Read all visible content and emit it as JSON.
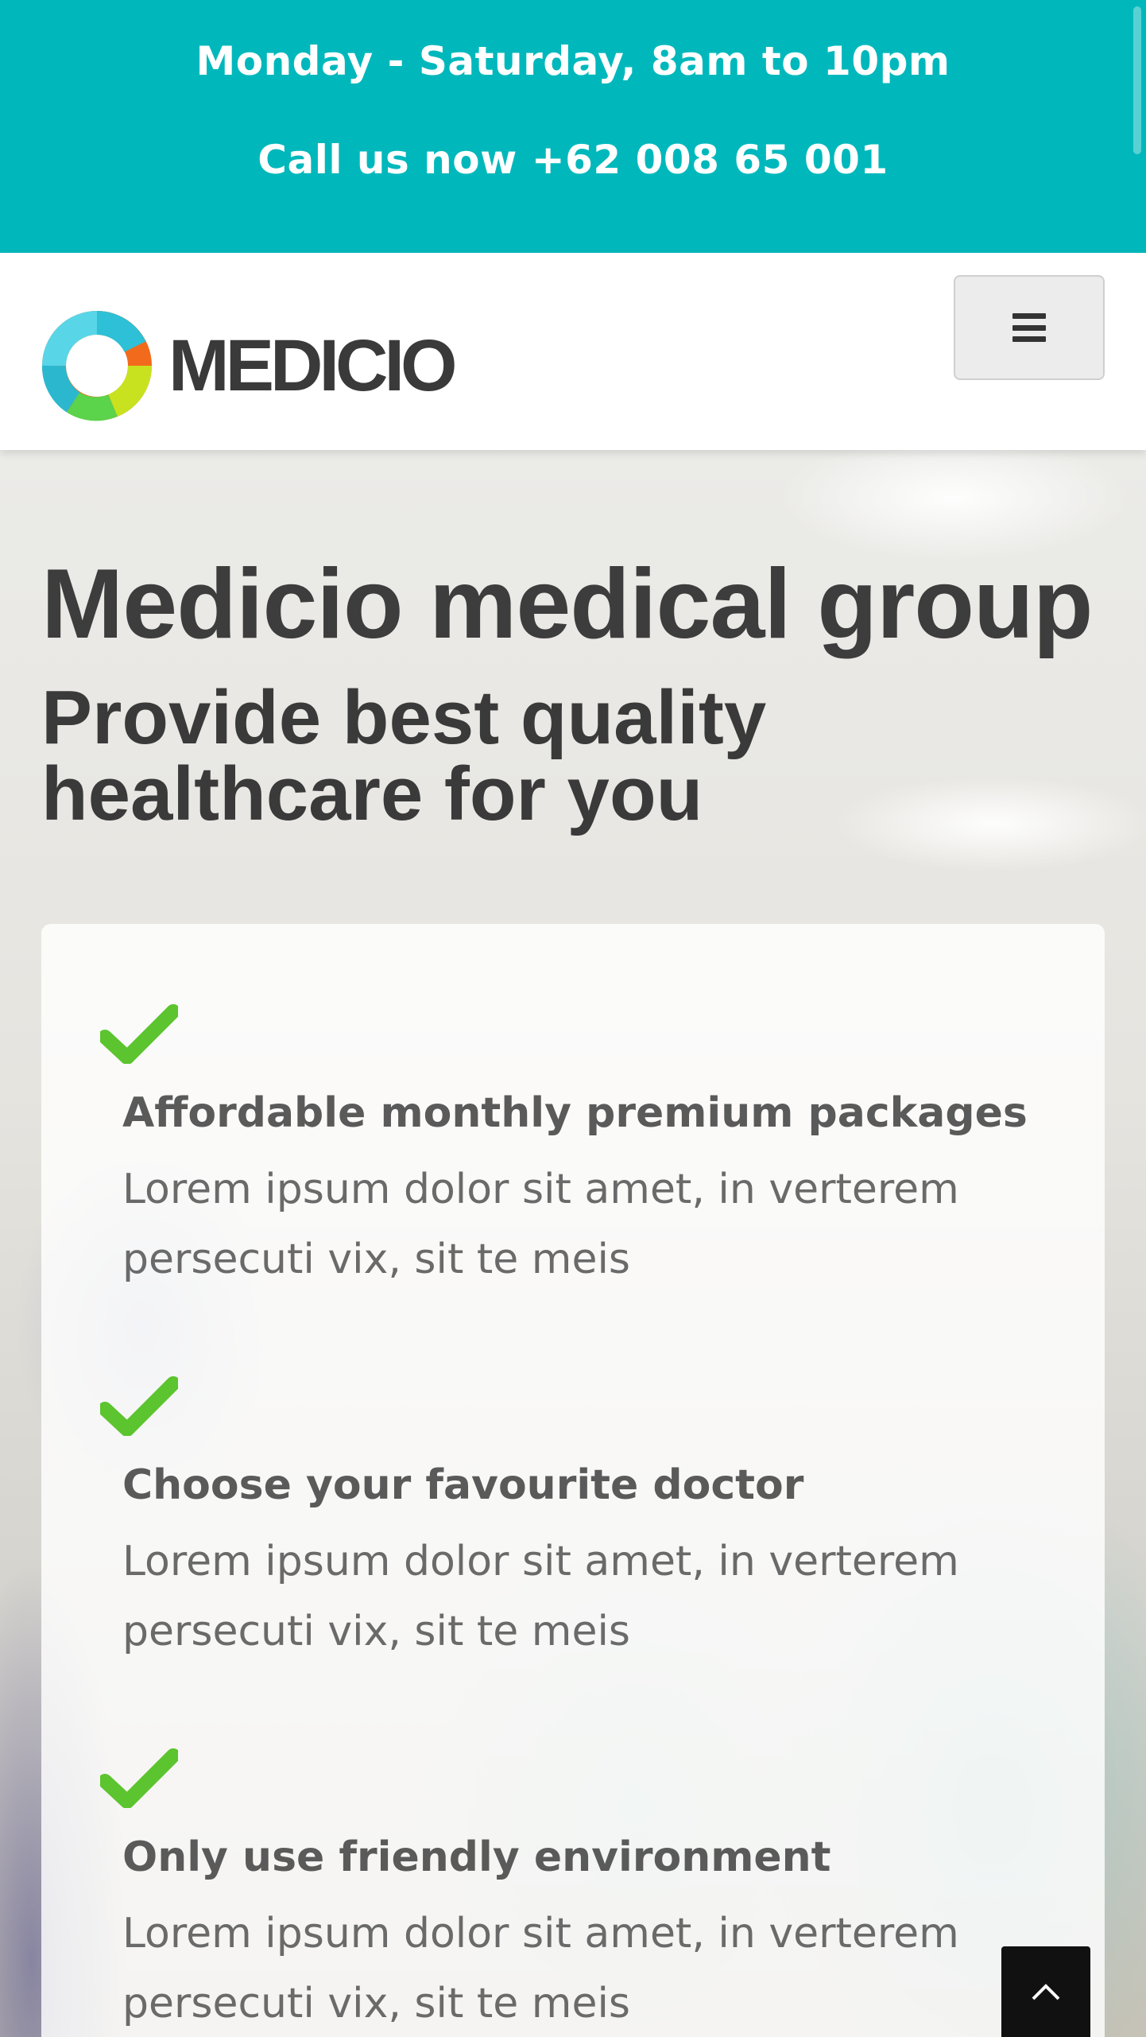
{
  "topbar": {
    "hours": "Monday - Saturday, 8am to 10pm",
    "phone": "Call us now +62 008 65 001"
  },
  "header": {
    "logo_text": "MEDICIO",
    "menu_icon": "hamburger-menu-icon"
  },
  "hero": {
    "title": "Medicio medical group",
    "subtitle": "Provide best quality healthcare for you"
  },
  "features": [
    {
      "icon": "checkmark-icon",
      "title": "Affordable monthly premium packages",
      "text": "Lorem ipsum dolor sit amet, in verterem persecuti vix, sit te meis"
    },
    {
      "icon": "checkmark-icon",
      "title": "Choose your favourite doctor",
      "text": "Lorem ipsum dolor sit amet, in verterem persecuti vix, sit te meis"
    },
    {
      "icon": "checkmark-icon",
      "title": "Only use friendly environment",
      "text": "Lorem ipsum dolor sit amet, in verterem persecuti vix, sit te meis"
    }
  ],
  "back_to_top_icon": "chevron-up-icon",
  "colors": {
    "topbar": "#00b8bc",
    "check": "#5cc42e",
    "heading": "#3d3d3d"
  }
}
